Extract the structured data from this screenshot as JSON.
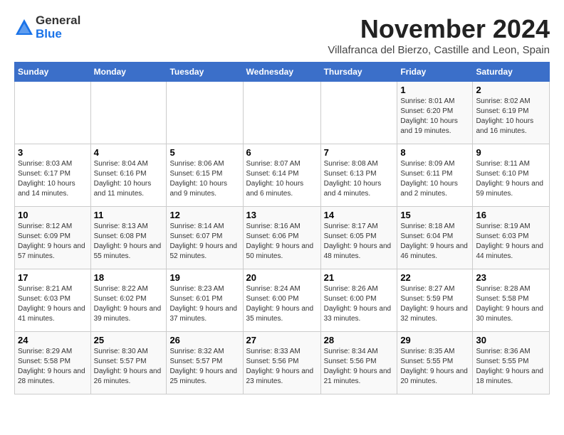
{
  "header": {
    "logo": {
      "general": "General",
      "blue": "Blue"
    },
    "title": "November 2024",
    "subtitle": "Villafranca del Bierzo, Castille and Leon, Spain"
  },
  "weekdays": [
    "Sunday",
    "Monday",
    "Tuesday",
    "Wednesday",
    "Thursday",
    "Friday",
    "Saturday"
  ],
  "weeks": [
    [
      {
        "day": "",
        "info": ""
      },
      {
        "day": "",
        "info": ""
      },
      {
        "day": "",
        "info": ""
      },
      {
        "day": "",
        "info": ""
      },
      {
        "day": "",
        "info": ""
      },
      {
        "day": "1",
        "info": "Sunrise: 8:01 AM\nSunset: 6:20 PM\nDaylight: 10 hours and 19 minutes."
      },
      {
        "day": "2",
        "info": "Sunrise: 8:02 AM\nSunset: 6:19 PM\nDaylight: 10 hours and 16 minutes."
      }
    ],
    [
      {
        "day": "3",
        "info": "Sunrise: 8:03 AM\nSunset: 6:17 PM\nDaylight: 10 hours and 14 minutes."
      },
      {
        "day": "4",
        "info": "Sunrise: 8:04 AM\nSunset: 6:16 PM\nDaylight: 10 hours and 11 minutes."
      },
      {
        "day": "5",
        "info": "Sunrise: 8:06 AM\nSunset: 6:15 PM\nDaylight: 10 hours and 9 minutes."
      },
      {
        "day": "6",
        "info": "Sunrise: 8:07 AM\nSunset: 6:14 PM\nDaylight: 10 hours and 6 minutes."
      },
      {
        "day": "7",
        "info": "Sunrise: 8:08 AM\nSunset: 6:13 PM\nDaylight: 10 hours and 4 minutes."
      },
      {
        "day": "8",
        "info": "Sunrise: 8:09 AM\nSunset: 6:11 PM\nDaylight: 10 hours and 2 minutes."
      },
      {
        "day": "9",
        "info": "Sunrise: 8:11 AM\nSunset: 6:10 PM\nDaylight: 9 hours and 59 minutes."
      }
    ],
    [
      {
        "day": "10",
        "info": "Sunrise: 8:12 AM\nSunset: 6:09 PM\nDaylight: 9 hours and 57 minutes."
      },
      {
        "day": "11",
        "info": "Sunrise: 8:13 AM\nSunset: 6:08 PM\nDaylight: 9 hours and 55 minutes."
      },
      {
        "day": "12",
        "info": "Sunrise: 8:14 AM\nSunset: 6:07 PM\nDaylight: 9 hours and 52 minutes."
      },
      {
        "day": "13",
        "info": "Sunrise: 8:16 AM\nSunset: 6:06 PM\nDaylight: 9 hours and 50 minutes."
      },
      {
        "day": "14",
        "info": "Sunrise: 8:17 AM\nSunset: 6:05 PM\nDaylight: 9 hours and 48 minutes."
      },
      {
        "day": "15",
        "info": "Sunrise: 8:18 AM\nSunset: 6:04 PM\nDaylight: 9 hours and 46 minutes."
      },
      {
        "day": "16",
        "info": "Sunrise: 8:19 AM\nSunset: 6:03 PM\nDaylight: 9 hours and 44 minutes."
      }
    ],
    [
      {
        "day": "17",
        "info": "Sunrise: 8:21 AM\nSunset: 6:03 PM\nDaylight: 9 hours and 41 minutes."
      },
      {
        "day": "18",
        "info": "Sunrise: 8:22 AM\nSunset: 6:02 PM\nDaylight: 9 hours and 39 minutes."
      },
      {
        "day": "19",
        "info": "Sunrise: 8:23 AM\nSunset: 6:01 PM\nDaylight: 9 hours and 37 minutes."
      },
      {
        "day": "20",
        "info": "Sunrise: 8:24 AM\nSunset: 6:00 PM\nDaylight: 9 hours and 35 minutes."
      },
      {
        "day": "21",
        "info": "Sunrise: 8:26 AM\nSunset: 6:00 PM\nDaylight: 9 hours and 33 minutes."
      },
      {
        "day": "22",
        "info": "Sunrise: 8:27 AM\nSunset: 5:59 PM\nDaylight: 9 hours and 32 minutes."
      },
      {
        "day": "23",
        "info": "Sunrise: 8:28 AM\nSunset: 5:58 PM\nDaylight: 9 hours and 30 minutes."
      }
    ],
    [
      {
        "day": "24",
        "info": "Sunrise: 8:29 AM\nSunset: 5:58 PM\nDaylight: 9 hours and 28 minutes."
      },
      {
        "day": "25",
        "info": "Sunrise: 8:30 AM\nSunset: 5:57 PM\nDaylight: 9 hours and 26 minutes."
      },
      {
        "day": "26",
        "info": "Sunrise: 8:32 AM\nSunset: 5:57 PM\nDaylight: 9 hours and 25 minutes."
      },
      {
        "day": "27",
        "info": "Sunrise: 8:33 AM\nSunset: 5:56 PM\nDaylight: 9 hours and 23 minutes."
      },
      {
        "day": "28",
        "info": "Sunrise: 8:34 AM\nSunset: 5:56 PM\nDaylight: 9 hours and 21 minutes."
      },
      {
        "day": "29",
        "info": "Sunrise: 8:35 AM\nSunset: 5:55 PM\nDaylight: 9 hours and 20 minutes."
      },
      {
        "day": "30",
        "info": "Sunrise: 8:36 AM\nSunset: 5:55 PM\nDaylight: 9 hours and 18 minutes."
      }
    ]
  ]
}
